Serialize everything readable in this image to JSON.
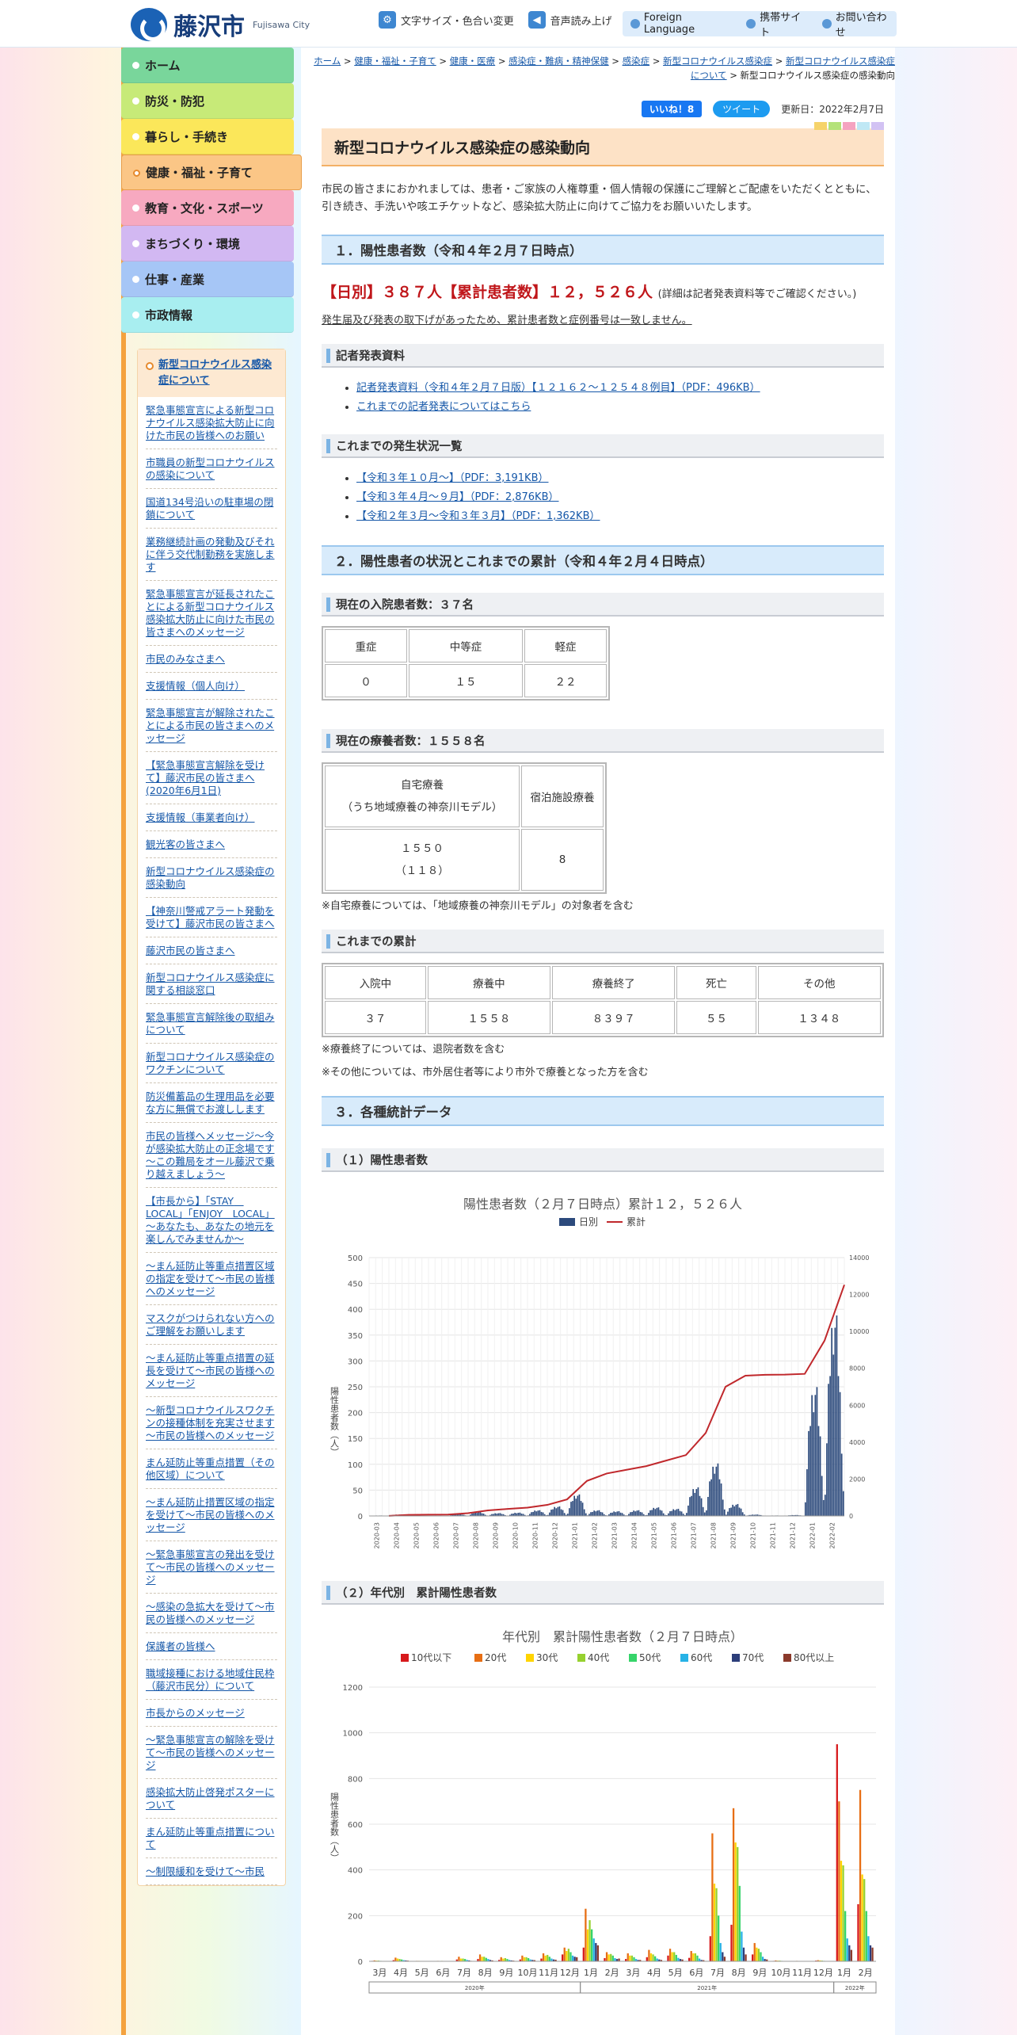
{
  "header": {
    "logo_ja": "藤沢市",
    "logo_en": "Fujisawa City",
    "tools": [
      {
        "icon": "gear-icon",
        "label": "文字サイズ・色合い変更"
      },
      {
        "icon": "speaker-icon",
        "label": "音声読み上げ"
      }
    ],
    "links": [
      "Foreign Language",
      "携帯サイト",
      "お問い合わせ"
    ]
  },
  "sidebar": {
    "nav": [
      {
        "label": "ホーム",
        "color": "#79d69b"
      },
      {
        "label": "防災・防犯",
        "color": "#c7ea78"
      },
      {
        "label": "暮らし・手続き",
        "color": "#fbe75a"
      },
      {
        "label": "健康・福祉・子育て",
        "color": "#fbc686"
      },
      {
        "label": "教育・文化・スポーツ",
        "color": "#f7a9c0"
      },
      {
        "label": "まちづくり・環境",
        "color": "#d2b8f2"
      },
      {
        "label": "仕事・産業",
        "color": "#a6c6f6"
      },
      {
        "label": "市政情報",
        "color": "#a8eef0"
      }
    ],
    "subnav_title": "新型コロナウイルス感染症について",
    "subnav_items": [
      "緊急事態宣言による新型コロナウイルス感染拡大防止に向けた市民の皆様へのお願い",
      "市職員の新型コロナウイルスの感染について",
      "国道134号沿いの駐車場の閉鎖について",
      "業務継続計画の発動及びそれに伴う交代制勤務を実施します",
      "緊急事態宣言が延長されたことによる新型コロナウイルス感染拡大防止に向けた市民の皆さまへのメッセージ",
      "市民のみなさまへ",
      "支援情報（個人向け）",
      "緊急事態宣言が解除されたことによる市民の皆さまへのメッセージ",
      "【緊急事態宣言解除を受けて】藤沢市民の皆さまへ(2020年6月1日)",
      "支援情報（事業者向け）",
      "観光客の皆さまへ",
      "新型コロナウイルス感染症の感染動向",
      "【神奈川警戒アラート発動を受けて】藤沢市民の皆さまへ",
      "藤沢市民の皆さまへ",
      "新型コロナウイルス感染症に関する相談窓口",
      "緊急事態宣言解除後の取組みについて",
      "新型コロナウイルス感染症のワクチンについて",
      "防災備蓄品の生理用品を必要な方に無償でお渡しします",
      "市民の皆様へメッセージ～今が感染拡大防止の正念場です～この難局をオール藤沢で乗り越えましょう～",
      "【市長から】「STAY　LOCAL」「ENJOY　LOCAL」～あなたも、あなたの地元を楽しんでみませんか～",
      "～まん延防止等重点措置区域の指定を受けて～市民の皆様へのメッセージ",
      "マスクがつけられない方へのご理解をお願いします",
      "～まん延防止等重点措置の延長を受けて～市民の皆様へのメッセージ",
      "～新型コロナウイルスワクチンの接種体制を充実させます～市民の皆様へのメッセージ",
      "まん延防止等重点措置（その他区域）について",
      "～まん延防止措置区域の指定を受けて～市民の皆様へのメッセージ",
      "～緊急事態宣言の発出を受けて～市民の皆様へのメッセージ",
      "～感染の急拡大を受けて～市民の皆様へのメッセージ",
      "保護者の皆様へ",
      "職域接種における地域住民枠（藤沢市民分）について",
      "市長からのメッセージ",
      "～緊急事態宣言の解除を受けて～市民の皆様へのメッセージ",
      "感染拡大防止啓発ポスターについて",
      "まん延防止等重点措置について",
      "～制限緩和を受けて～市民"
    ]
  },
  "breadcrumb": [
    "ホーム",
    "健康・福祉・子育て",
    "健康・医療",
    "感染症・難病・精神保健",
    "感染症",
    "新型コロナウイルス感染症",
    "新型コロナウイルス感染症について",
    "新型コロナウイルス感染症の感染動向"
  ],
  "social": {
    "like": "いいね！8",
    "tweet": "ツイート",
    "updated": "更新日：2022年2月7日"
  },
  "page_title": "新型コロナウイルス感染症の感染動向",
  "intro": "市民の皆さまにおかれましては、患者・ご家族の人権尊重・個人情報の保護にご理解とご配慮をいただくとともに、引き続き、手洗いや咳エチケットなど、感染拡大防止に向けてご協力をお願いいたします。",
  "s1": {
    "heading": "１．陽性患者数（令和４年２月７日時点）",
    "daily": "【日別】３８７人【累計患者数】１２，５２６人",
    "daily_note": "(詳細は記者発表資料等でご確認ください。)",
    "note": "発生届及び発表の取下げがあったため、累計患者数と症例番号は一致しません。",
    "press_heading": "記者発表資料",
    "press_links": [
      "記者発表資料（令和４年２月７日版）【１２１６２～１２５４８例目】（PDF：496KB）",
      "これまでの記者発表についてはこちら"
    ],
    "history_heading": "これまでの発生状況一覧",
    "history_links": [
      "【令和３年１０月～】（PDF：3,191KB）",
      "【令和３年４月～９月】（PDF：2,876KB）",
      "【令和２年３月～令和３年３月】（PDF：1,362KB）"
    ]
  },
  "s2": {
    "heading": "２．陽性患者の状況とこれまでの累計（令和４年２月４日時点）",
    "inpatient_heading": "現在の入院患者数：３７名",
    "inpatient_headers": [
      "重症",
      "中等症",
      "軽症"
    ],
    "inpatient_values": [
      "０",
      "１５",
      "２２"
    ],
    "recovery_heading": "現在の療養者数：１５５８名",
    "recovery_h1a": "自宅療養",
    "recovery_h1b": "（うち地域療養の神奈川モデル）",
    "recovery_h2": "宿泊施設療養",
    "recovery_v1a": "１５５０",
    "recovery_v1b": "（１１８）",
    "recovery_v2": "8",
    "recovery_note": "※自宅療養については、「地域療養の神奈川モデル」の対象者を含む",
    "total_heading": "これまでの累計",
    "total_headers": [
      "入院中",
      "療養中",
      "療養終了",
      "死亡",
      "その他"
    ],
    "total_values": [
      "３７",
      "１５５８",
      "８３９７",
      "５５",
      "１３４８"
    ],
    "total_note1": "※療養終了については、退院者数を含む",
    "total_note2": "※その他については、市外居住者等により市外で療養となった方を含む"
  },
  "s3": {
    "heading": "３．各種統計データ",
    "sub1": "（１）陽性患者数",
    "sub2": "（２）年代別　累計陽性患者数"
  },
  "chart_data": [
    {
      "type": "bar+line",
      "title": "陽性患者数（２月７日時点）累計１２，５２６人",
      "legend": [
        "日別",
        "累計"
      ],
      "ylabel": "陽性患者数（人）",
      "ylim": [
        0,
        500
      ],
      "y2lim": [
        0,
        14000
      ],
      "yticks": [
        0,
        50,
        100,
        150,
        200,
        250,
        300,
        350,
        400,
        450,
        500
      ],
      "y2ticks": [
        0,
        2000,
        4000,
        6000,
        8000,
        10000,
        12000,
        14000
      ],
      "x": [
        "2020-03",
        "2020-04",
        "2020-05",
        "2020-06",
        "2020-07",
        "2020-08",
        "2020-09",
        "2020-10",
        "2020-11",
        "2020-12",
        "2021-01",
        "2021-02",
        "2021-03",
        "2021-04",
        "2021-05",
        "2021-06",
        "2021-07",
        "2021-08",
        "2021-09",
        "2021-10",
        "2021-11",
        "2021-12",
        "2022-01",
        "2022-02"
      ],
      "daily_peak": [
        1,
        3,
        1,
        1,
        4,
        8,
        6,
        7,
        12,
        20,
        45,
        12,
        10,
        12,
        18,
        15,
        60,
        110,
        25,
        3,
        1,
        2,
        270,
        420
      ],
      "cumulative": [
        5,
        60,
        70,
        75,
        150,
        300,
        380,
        450,
        600,
        900,
        1900,
        2300,
        2500,
        2700,
        3000,
        3300,
        4500,
        7000,
        7600,
        7650,
        7660,
        7700,
        9500,
        12526
      ]
    },
    {
      "type": "bar",
      "title": "年代別　累計陽性患者数（２月７日時点）",
      "ylabel": "陽性患者数（人）",
      "ylim": [
        0,
        1200
      ],
      "yticks": [
        0,
        200,
        400,
        600,
        800,
        1000,
        1200
      ],
      "categories": [
        "3月",
        "4月",
        "5月",
        "6月",
        "7月",
        "8月",
        "9月",
        "10月",
        "11月",
        "12月",
        "1月",
        "2月",
        "3月",
        "4月",
        "5月",
        "6月",
        "7月",
        "8月",
        "9月",
        "10月",
        "11月",
        "12月",
        "1月",
        "2月"
      ],
      "year_labels": [
        "2020年",
        "2021年",
        "2022年"
      ],
      "series": [
        {
          "name": "10代以下",
          "color": "#d7191c",
          "values": [
            2,
            5,
            1,
            1,
            8,
            10,
            6,
            8,
            12,
            30,
            60,
            14,
            10,
            18,
            25,
            15,
            110,
            160,
            30,
            2,
            1,
            3,
            950,
            250
          ]
        },
        {
          "name": "20代",
          "color": "#e76e14",
          "values": [
            4,
            16,
            2,
            2,
            20,
            30,
            18,
            25,
            35,
            60,
            230,
            40,
            35,
            50,
            55,
            45,
            560,
            670,
            80,
            4,
            2,
            5,
            700,
            750
          ]
        },
        {
          "name": "30代",
          "color": "#ffd400",
          "values": [
            3,
            12,
            2,
            1,
            12,
            20,
            12,
            18,
            25,
            45,
            140,
            30,
            25,
            35,
            40,
            35,
            340,
            520,
            60,
            3,
            1,
            4,
            440,
            380
          ]
        },
        {
          "name": "40代",
          "color": "#96d12f",
          "values": [
            3,
            10,
            1,
            2,
            12,
            20,
            14,
            18,
            28,
            55,
            180,
            32,
            25,
            30,
            40,
            35,
            320,
            500,
            55,
            3,
            1,
            3,
            420,
            360
          ]
        },
        {
          "name": "50代",
          "color": "#36d46a",
          "values": [
            2,
            8,
            1,
            1,
            10,
            15,
            10,
            14,
            20,
            40,
            140,
            25,
            18,
            22,
            28,
            25,
            200,
            330,
            40,
            2,
            1,
            2,
            220,
            220
          ]
        },
        {
          "name": "60代",
          "color": "#27b2e6",
          "values": [
            1,
            5,
            1,
            1,
            6,
            10,
            6,
            8,
            12,
            25,
            100,
            14,
            10,
            12,
            15,
            12,
            80,
            130,
            20,
            1,
            0,
            1,
            100,
            110
          ]
        },
        {
          "name": "70代",
          "color": "#2c3e7a",
          "values": [
            1,
            4,
            0,
            0,
            4,
            6,
            4,
            6,
            8,
            20,
            80,
            10,
            6,
            8,
            10,
            6,
            40,
            60,
            10,
            1,
            0,
            1,
            70,
            70
          ]
        },
        {
          "name": "80代以上",
          "color": "#8b3a2b",
          "values": [
            1,
            3,
            0,
            0,
            2,
            4,
            3,
            5,
            7,
            18,
            70,
            12,
            6,
            6,
            8,
            5,
            20,
            30,
            8,
            0,
            0,
            0,
            50,
            60
          ]
        }
      ]
    }
  ]
}
